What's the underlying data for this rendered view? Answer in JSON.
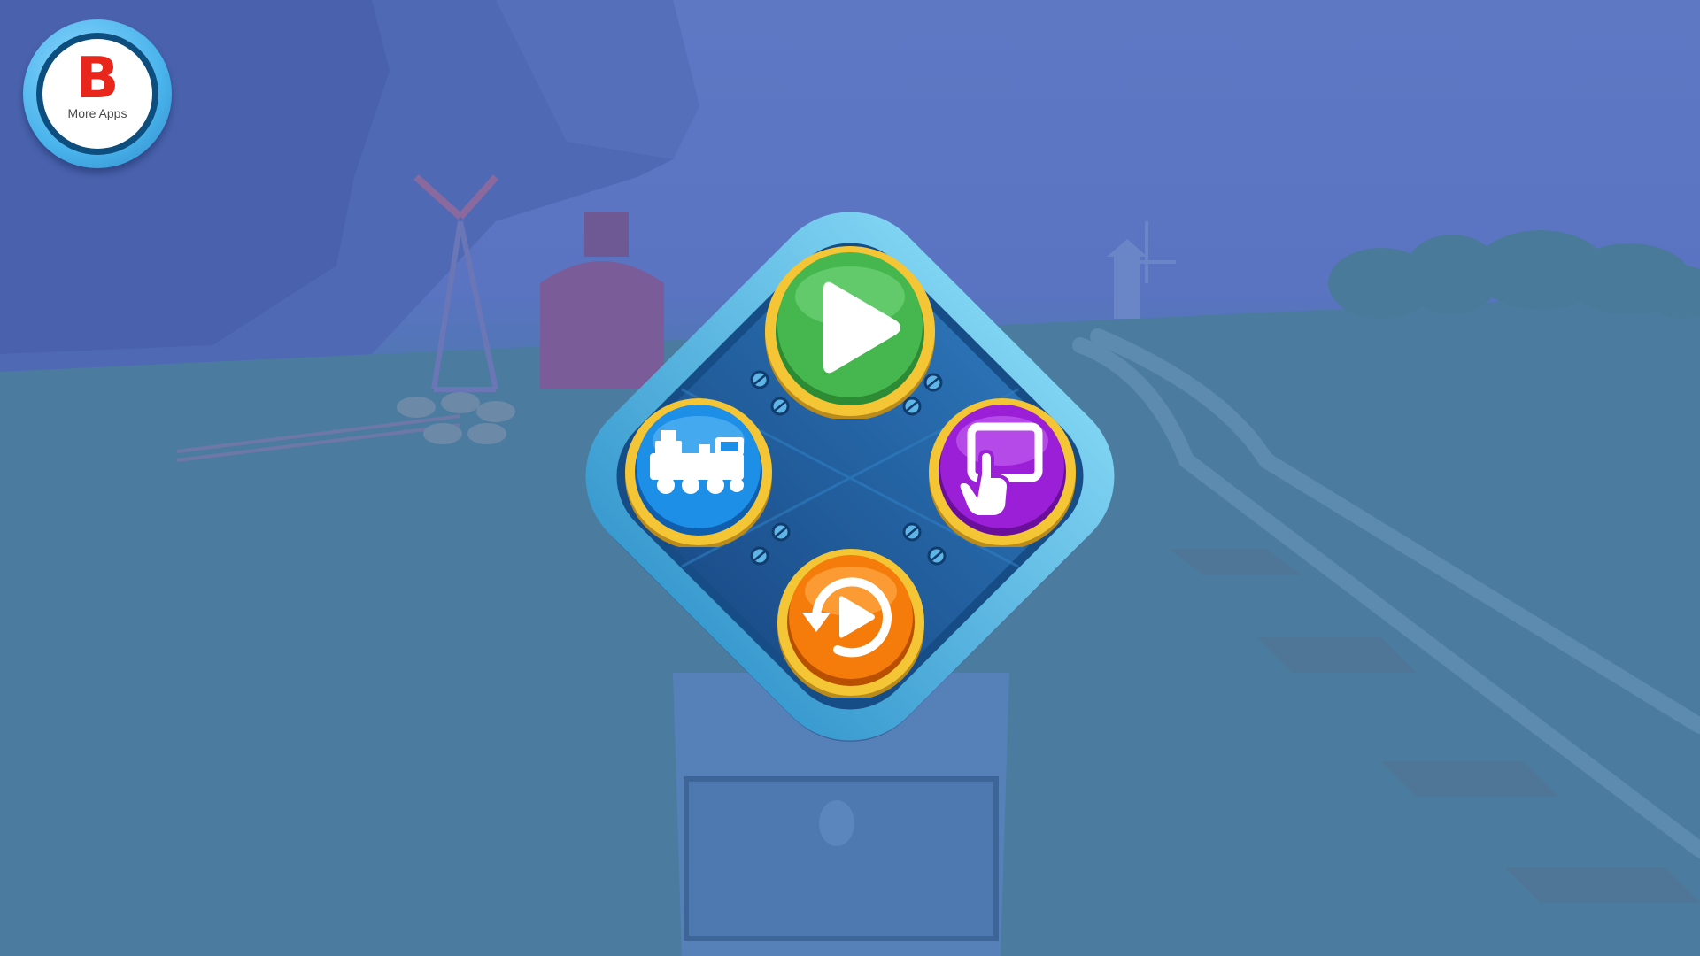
{
  "more_apps": {
    "logo_letter": "B",
    "label": "More Apps"
  },
  "menu_buttons": [
    {
      "name": "play",
      "icon": "play-icon",
      "color": "#3fb34a"
    },
    {
      "name": "trains",
      "icon": "train-icon",
      "color": "#1e8fe6"
    },
    {
      "name": "screen-touch",
      "icon": "touch-screen-icon",
      "color": "#9b1fd6"
    },
    {
      "name": "replay",
      "icon": "replay-icon",
      "color": "#f57c0a"
    }
  ],
  "colors": {
    "panel_frame": "#4fb3e0",
    "panel_inner": "#1f5e9e",
    "button_rim": "#f2c230"
  }
}
